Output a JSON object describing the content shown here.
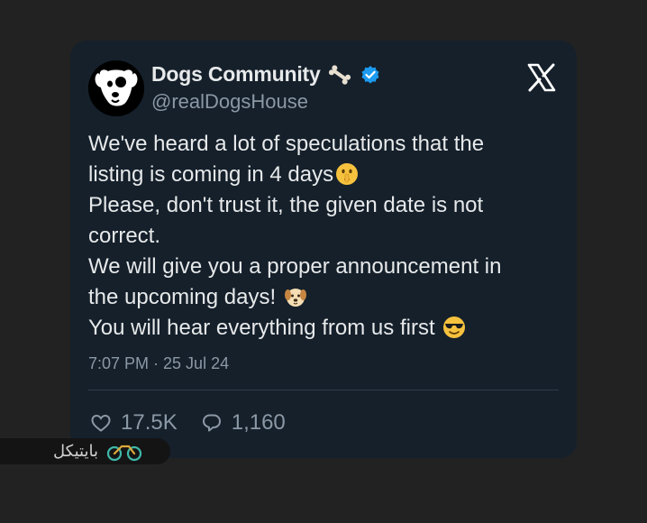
{
  "author": {
    "display_name": "Dogs Community",
    "name_emoji_icon": "bone-icon",
    "verified": true,
    "handle": "@realDogsHouse"
  },
  "platform_icon": "x-logo-icon",
  "tweet": {
    "lines": [
      "We've heard a lot of speculations that the",
      "listing is coming in 4 days",
      "Please, don't trust it, the given date is not",
      "correct.",
      "We will give you a proper announcement in",
      "the upcoming days!",
      "You will hear everything from us first"
    ],
    "emojis": [
      "shushing-face",
      "dog-face",
      "sunglasses-face"
    ]
  },
  "timestamp": "7:07 PM · 25 Jul 24",
  "stats": {
    "likes": "17.5K",
    "replies": "1,160"
  },
  "watermark": {
    "text": "بایتیکل",
    "icon": "bicycle-logo-icon"
  },
  "colors": {
    "page_background": "#222222",
    "card_background": "#15202b",
    "primary_text": "#e7e9ea",
    "secondary_text": "#8b98a5",
    "verified_blue": "#1d9bf0"
  }
}
